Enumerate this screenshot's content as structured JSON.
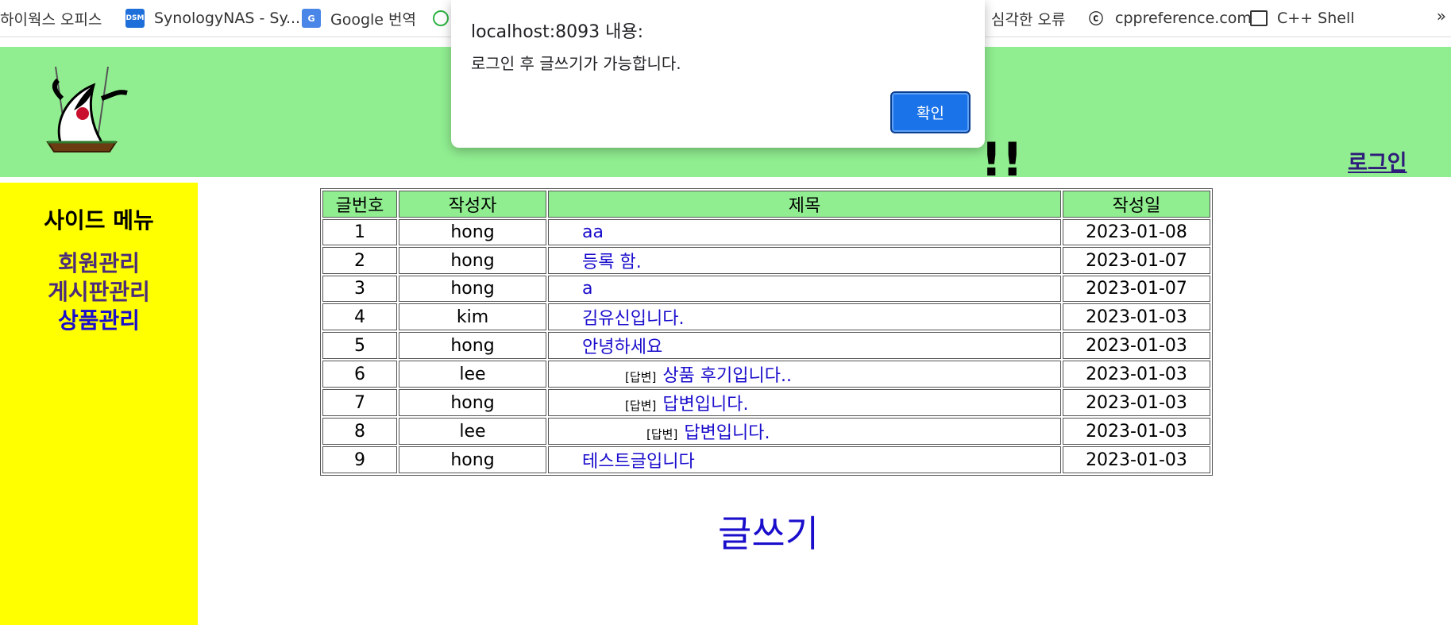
{
  "bookmarks": [
    {
      "label": "하이웍스 오피스",
      "icon": "none"
    },
    {
      "label": "SynologyNAS - Sy...",
      "icon": "dsm-icon"
    },
    {
      "label": "Google 번역",
      "icon": "google-translate-icon"
    },
    {
      "label": "심각한 오류",
      "icon": "none"
    },
    {
      "label": "cppreference.com",
      "icon": "cppreference-icon"
    },
    {
      "label": "C++ Shell",
      "icon": "window-icon"
    }
  ],
  "bookmarks_overflow": "»",
  "header": {
    "title_visible": "!!",
    "login_label": "로그인"
  },
  "sidebar": {
    "heading": "사이드 메뉴",
    "items": [
      {
        "label": "회원관리",
        "color": "#4b2c7a"
      },
      {
        "label": "게시판관리",
        "color": "#4b2c7a"
      },
      {
        "label": "상품관리",
        "color": "#1a0dcc"
      }
    ]
  },
  "board": {
    "headers": [
      "글번호",
      "작성자",
      "제목",
      "작성일"
    ],
    "rows": [
      {
        "no": "1",
        "writer": "hong",
        "reply": "",
        "title": "aa",
        "date": "2023-01-08"
      },
      {
        "no": "2",
        "writer": "hong",
        "reply": "",
        "title": "등록 함.",
        "date": "2023-01-07"
      },
      {
        "no": "3",
        "writer": "hong",
        "reply": "",
        "title": "a",
        "date": "2023-01-07"
      },
      {
        "no": "4",
        "writer": "kim",
        "reply": "",
        "title": "김유신입니다.",
        "date": "2023-01-03"
      },
      {
        "no": "5",
        "writer": "hong",
        "reply": "",
        "title": "안녕하세요",
        "date": "2023-01-03"
      },
      {
        "no": "6",
        "writer": "lee",
        "reply": "[답변]",
        "title": "상품 후기입니다..",
        "date": "2023-01-03"
      },
      {
        "no": "7",
        "writer": "hong",
        "reply": "[답변]",
        "title": "답변입니다.",
        "date": "2023-01-03"
      },
      {
        "no": "8",
        "writer": "lee",
        "reply": "[답변]",
        "title": "답변입니다.",
        "date": "2023-01-03"
      },
      {
        "no": "9",
        "writer": "hong",
        "reply": "",
        "title": "테스트글입니다",
        "date": "2023-01-03"
      }
    ],
    "write_label": "글쓰기"
  },
  "dialog": {
    "title": "localhost:8093 내용:",
    "message": "로그인 후 글쓰기가 가능합니다.",
    "ok_label": "확인"
  },
  "colors": {
    "header_bg": "#90ee90",
    "sidebar_bg": "#ffff00",
    "link": "#1a0dcc",
    "dialog_button": "#1a73e8"
  }
}
